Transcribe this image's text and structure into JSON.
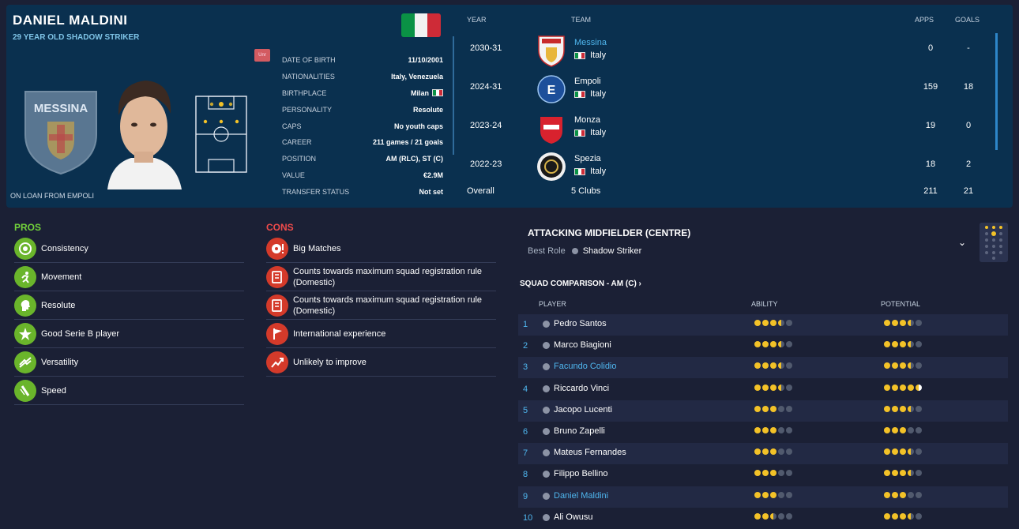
{
  "player": {
    "name": "DANIEL MALDINI",
    "subtitle": "29 YEAR OLD SHADOW STRIKER",
    "loan": "ON LOAN FROM EMPOLI",
    "unr": "Unr",
    "badge_text": "MESSINA"
  },
  "info": [
    {
      "k": "DATE OF BIRTH",
      "v": "11/10/2001"
    },
    {
      "k": "NATIONALITIES",
      "v": "Italy, Venezuela"
    },
    {
      "k": "BIRTHPLACE",
      "v": "Milan"
    },
    {
      "k": "PERSONALITY",
      "v": "Resolute"
    },
    {
      "k": "CAPS",
      "v": "No youth caps"
    },
    {
      "k": "CAREER",
      "v": "211 games / 21 goals"
    },
    {
      "k": "POSITION",
      "v": "AM (RLC), ST (C)"
    },
    {
      "k": "VALUE",
      "v": "€2.9M"
    },
    {
      "k": "TRANSFER STATUS",
      "v": "Not set"
    }
  ],
  "history": {
    "headers": {
      "year": "YEAR",
      "team": "TEAM",
      "apps": "APPS",
      "goals": "GOALS"
    },
    "rows": [
      {
        "year": "2030-31",
        "club": "Messina",
        "nat": "Italy",
        "apps": "0",
        "goals": "-"
      },
      {
        "year": "2024-31",
        "club": "Empoli",
        "nat": "Italy",
        "apps": "159",
        "goals": "18"
      },
      {
        "year": "2023-24",
        "club": "Monza",
        "nat": "Italy",
        "apps": "19",
        "goals": "0"
      },
      {
        "year": "2022-23",
        "club": "Spezia",
        "nat": "Italy",
        "apps": "18",
        "goals": "2"
      }
    ],
    "overall": {
      "label": "Overall",
      "clubs": "5 Clubs",
      "apps": "211",
      "goals": "21"
    }
  },
  "pros": {
    "title": "PROS",
    "items": [
      "Consistency",
      "Movement",
      "Resolute",
      "Good Serie B player",
      "Versatility",
      "Speed"
    ]
  },
  "cons": {
    "title": "CONS",
    "items": [
      "Big Matches",
      "Counts towards maximum squad registration rule (Domestic)",
      "Counts towards maximum squad registration rule (Domestic)",
      "International experience",
      "Unlikely to improve"
    ]
  },
  "role": {
    "title": "ATTACKING MIDFIELDER (CENTRE)",
    "best_label": "Best Role",
    "best_value": "Shadow Striker"
  },
  "squad": {
    "title": "SQUAD COMPARISON - AM (C)",
    "headers": {
      "player": "PLAYER",
      "ability": "ABILITY",
      "potential": "POTENTIAL"
    },
    "rows": [
      {
        "n": "1",
        "name": "Pedro Santos",
        "ability": 3.5,
        "potential": 3.5
      },
      {
        "n": "2",
        "name": "Marco Biagioni",
        "ability": 3.5,
        "potential": 3.5
      },
      {
        "n": "3",
        "name": "Facundo Colidio",
        "ability": 3.5,
        "potential": 3.5,
        "hl": true
      },
      {
        "n": "4",
        "name": "Riccardo Vinci",
        "ability": 3.5,
        "potential": 4.5
      },
      {
        "n": "5",
        "name": "Jacopo Lucenti",
        "ability": 3,
        "potential": 3.5
      },
      {
        "n": "6",
        "name": "Bruno Zapelli",
        "ability": 3,
        "potential": 3
      },
      {
        "n": "7",
        "name": "Mateus Fernandes",
        "ability": 3,
        "potential": 3.5
      },
      {
        "n": "8",
        "name": "Filippo Bellino",
        "ability": 3,
        "potential": 3.5
      },
      {
        "n": "9",
        "name": "Daniel Maldini",
        "ability": 3,
        "potential": 3,
        "hl": true
      },
      {
        "n": "10",
        "name": "Ali Owusu",
        "ability": 2.5,
        "potential": 3.5
      }
    ]
  }
}
